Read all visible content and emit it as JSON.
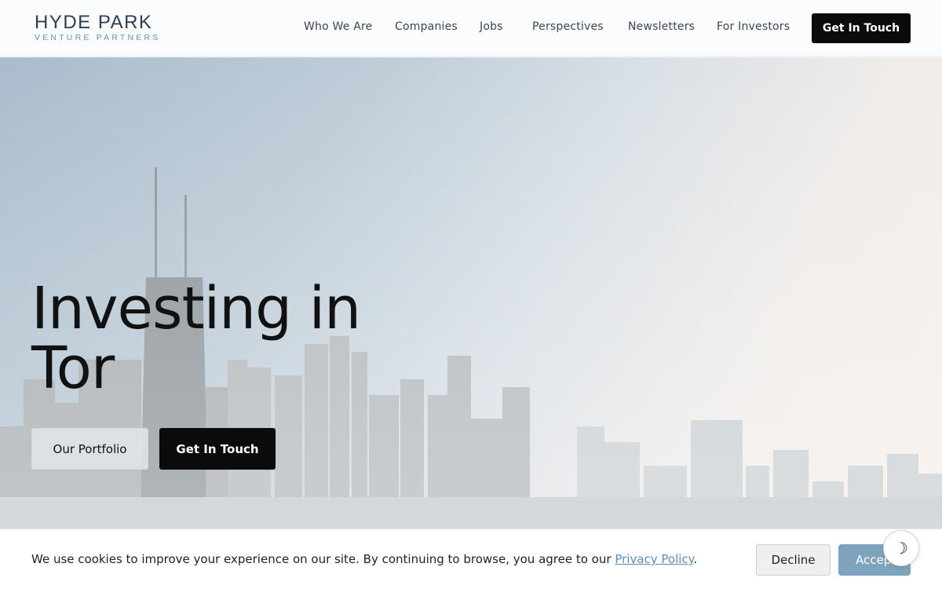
{
  "header": {
    "logo": {
      "name": "HYDE PARK",
      "tagline": "VENTURE PARTNERS"
    },
    "nav": [
      {
        "label": "Who We Are"
      },
      {
        "label": "Companies"
      },
      {
        "label": "Jobs"
      },
      {
        "label": "Perspectives"
      },
      {
        "label": "Newsletters"
      },
      {
        "label": "For Investors"
      }
    ],
    "cta_label": "Get In Touch"
  },
  "hero": {
    "title_line1": "Investing in",
    "title_line2": "Tor",
    "portfolio_label": "Our Portfolio",
    "touch_label": "Get In Touch"
  },
  "cookie_banner": {
    "text": "We use cookies to improve your experience on our site. By continuing to browse, you agree to our",
    "link_label": "Privacy Policy",
    "suffix": ".",
    "decline_label": "Decline",
    "accept_label": "Accept"
  },
  "theme_toggle": {
    "icon": "moon-icon",
    "glyph": "☽"
  },
  "colors": {
    "brand_dark": "#2b3f52",
    "brand_blue": "#5a95bd",
    "button_dark": "#0b0b0b",
    "accept_button": "#7ea4bd"
  }
}
